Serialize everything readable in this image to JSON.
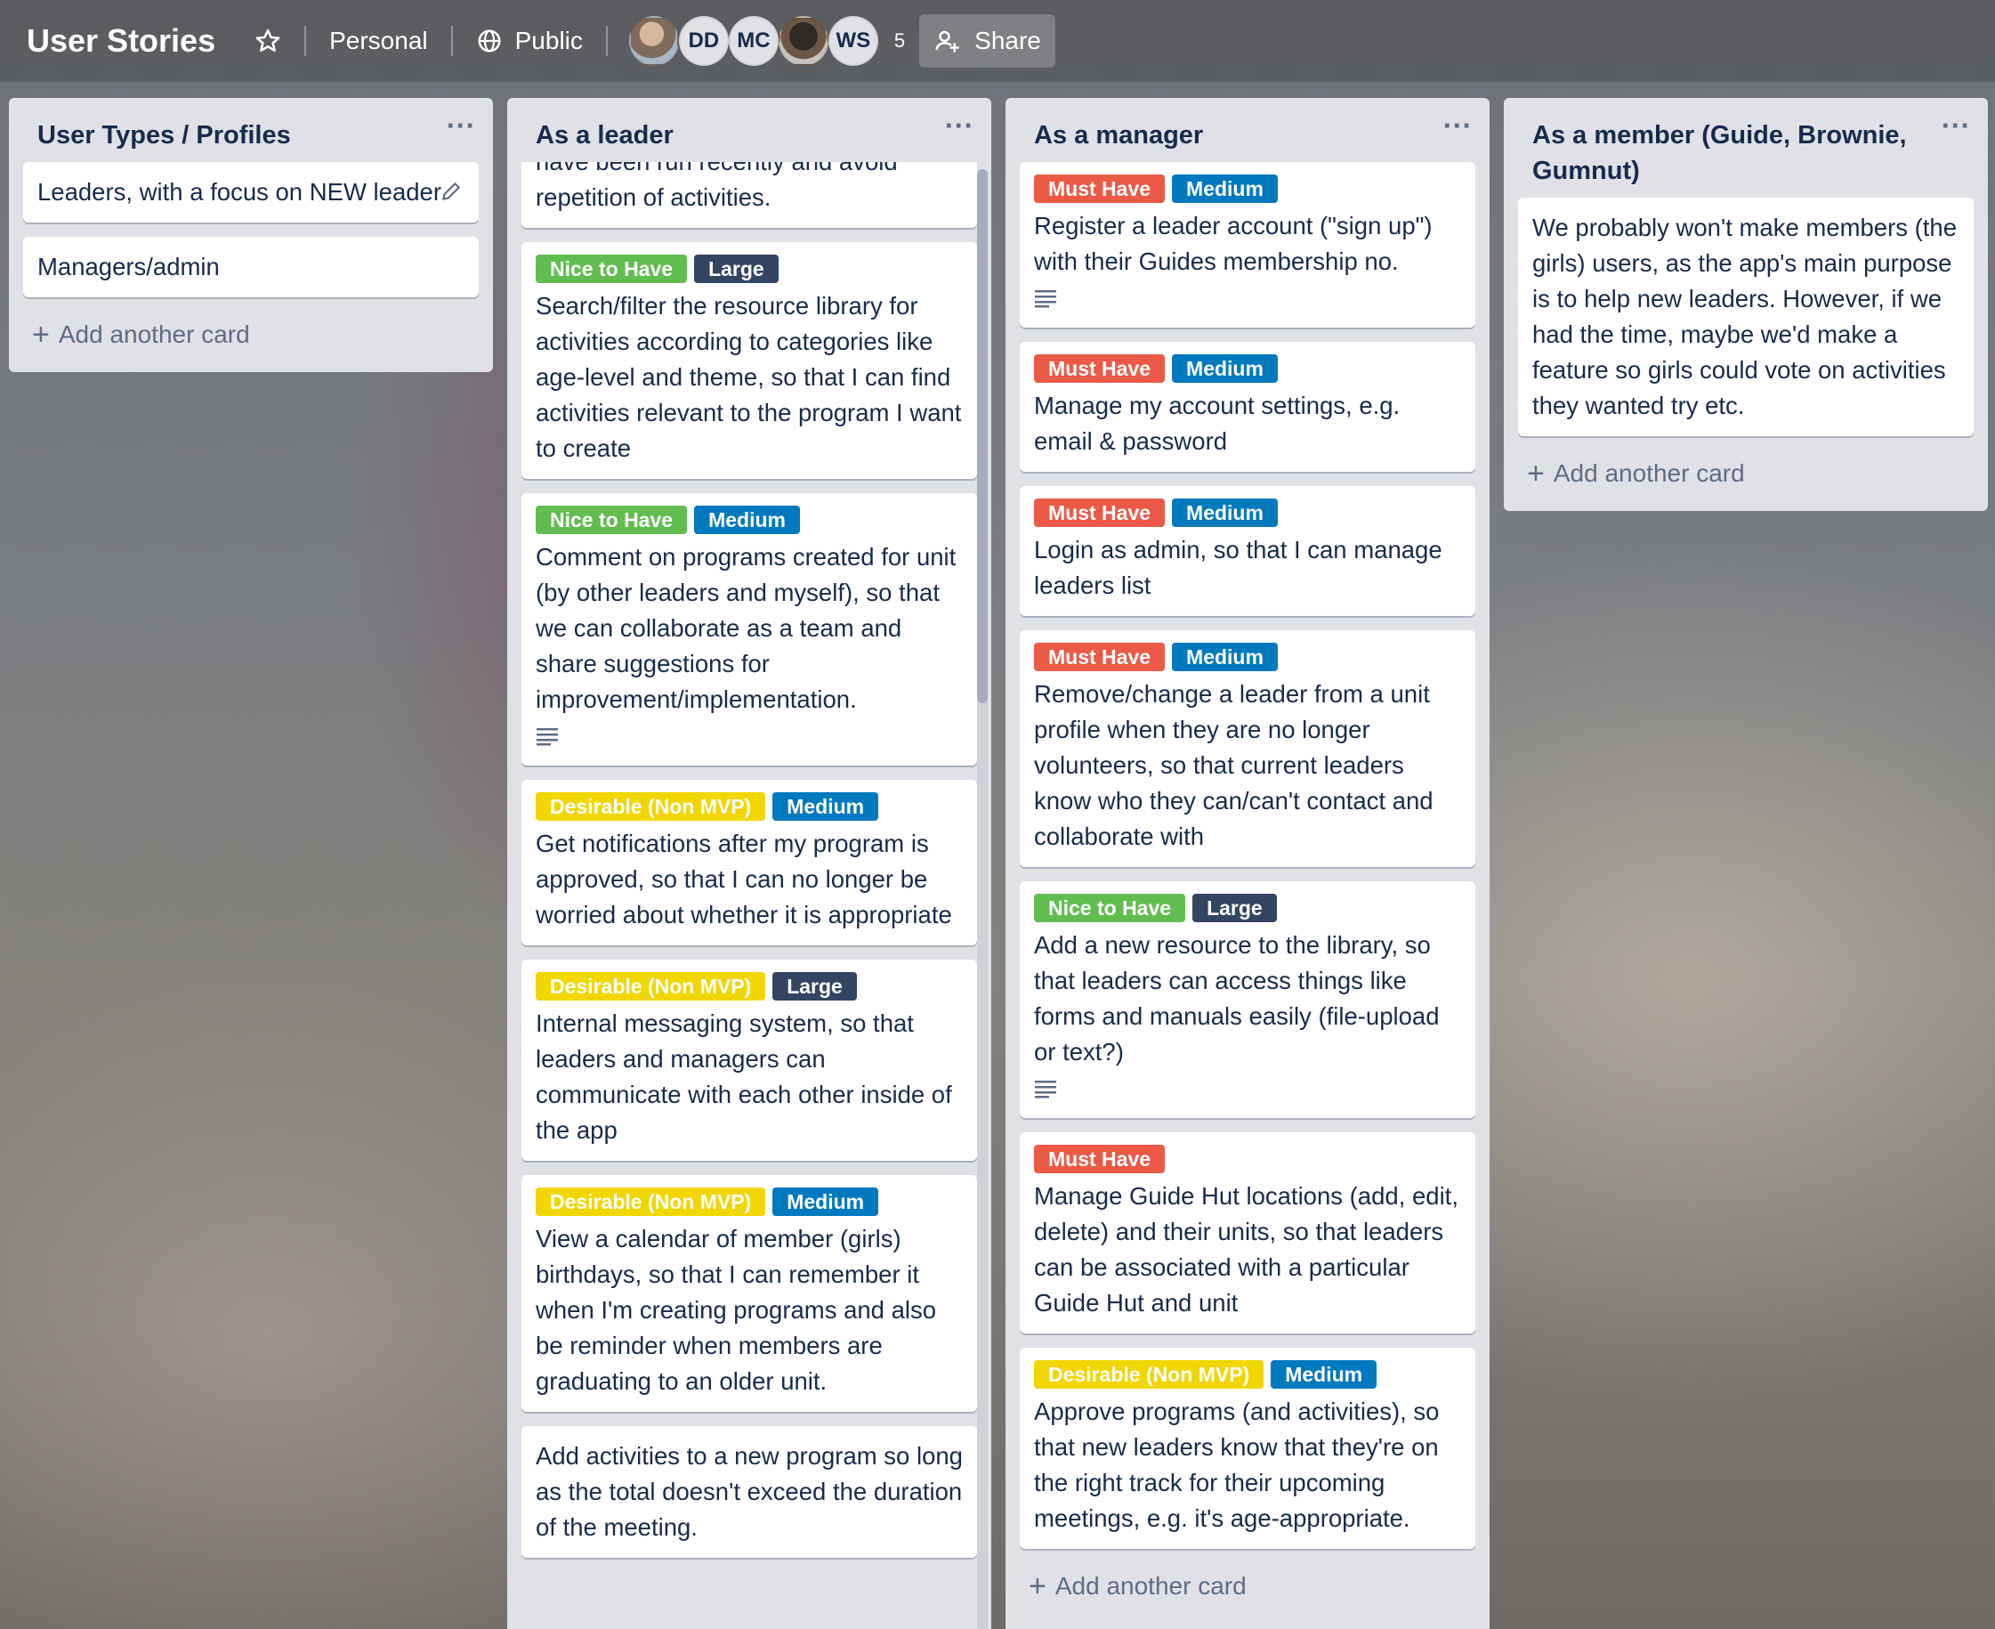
{
  "header": {
    "board_title": "User Stories",
    "visibility_team": "Personal",
    "visibility": "Public",
    "members": [
      {
        "initials": "",
        "kind": "photo"
      },
      {
        "initials": "DD",
        "kind": "initials"
      },
      {
        "initials": "MC",
        "kind": "initials"
      },
      {
        "initials": "",
        "kind": "photo"
      },
      {
        "initials": "WS",
        "kind": "initials"
      }
    ],
    "member_count": "5",
    "share_label": "Share"
  },
  "lists": [
    {
      "title": "User Types / Profiles",
      "cards": [
        {
          "text": "Leaders, with a focus on NEW leaders",
          "labels": []
        },
        {
          "text": "Managers/admin",
          "labels": []
        }
      ],
      "add_label": "Add another card"
    },
    {
      "title": "As a leader",
      "cards": [
        {
          "text": "have been run recently and avoid repetition of activities.",
          "labels": []
        },
        {
          "text": "Search/filter the resource library for activities according to categories like age-level and theme, so that I can find activities relevant to the program I want to create",
          "labels": [
            {
              "text": "Nice to Have",
              "color": "green"
            },
            {
              "text": "Large",
              "color": "dark"
            }
          ]
        },
        {
          "text": "Comment on programs created for unit (by other leaders and myself), so that we can collaborate as a team and share suggestions for improvement/implementation.",
          "labels": [
            {
              "text": "Nice to Have",
              "color": "green"
            },
            {
              "text": "Medium",
              "color": "blue"
            }
          ],
          "has_description": true
        },
        {
          "text": "Get notifications after my program is approved, so that I can no longer be worried about whether it is appropriate",
          "labels": [
            {
              "text": "Desirable (Non MVP)",
              "color": "yellow"
            },
            {
              "text": "Medium",
              "color": "blue"
            }
          ]
        },
        {
          "text": "Internal messaging system, so that leaders and managers can communicate with each other inside of the app",
          "labels": [
            {
              "text": "Desirable (Non MVP)",
              "color": "yellow"
            },
            {
              "text": "Large",
              "color": "dark"
            }
          ]
        },
        {
          "text": "View a calendar of member (girls) birthdays, so that I can remember it when I'm creating programs and also be reminder when members are graduating to an older unit.",
          "labels": [
            {
              "text": "Desirable (Non MVP)",
              "color": "yellow"
            },
            {
              "text": "Medium",
              "color": "blue"
            }
          ]
        },
        {
          "text": "Add activities to a new program so long as the total doesn't exceed the duration of the meeting.",
          "labels": []
        }
      ],
      "add_label": "Add another card"
    },
    {
      "title": "As a manager",
      "cards": [
        {
          "text": "Register a leader account (\"sign up\") with their Guides membership no.",
          "labels": [
            {
              "text": "Must Have",
              "color": "red"
            },
            {
              "text": "Medium",
              "color": "blue"
            }
          ],
          "has_description": true
        },
        {
          "text": "Manage my account settings, e.g. email & password",
          "labels": [
            {
              "text": "Must Have",
              "color": "red"
            },
            {
              "text": "Medium",
              "color": "blue"
            }
          ]
        },
        {
          "text": "Login as admin, so that I can manage leaders list",
          "labels": [
            {
              "text": "Must Have",
              "color": "red"
            },
            {
              "text": "Medium",
              "color": "blue"
            }
          ]
        },
        {
          "text": "Remove/change a leader from a unit profile when they are no longer volunteers, so that current leaders know who they can/can't contact and collaborate with",
          "labels": [
            {
              "text": "Must Have",
              "color": "red"
            },
            {
              "text": "Medium",
              "color": "blue"
            }
          ]
        },
        {
          "text": "Add a new resource to the library, so that leaders can access things like forms and manuals easily (file-upload or text?)",
          "labels": [
            {
              "text": "Nice to Have",
              "color": "green"
            },
            {
              "text": "Large",
              "color": "dark"
            }
          ],
          "has_description": true
        },
        {
          "text": "Manage Guide Hut locations (add, edit, delete) and their units, so that leaders can be associated with a particular Guide Hut and unit",
          "labels": [
            {
              "text": "Must Have",
              "color": "red"
            }
          ]
        },
        {
          "text": "Approve programs (and activities), so that new leaders know that they're on the right track for their upcoming meetings, e.g. it's age-appropriate.",
          "labels": [
            {
              "text": "Desirable (Non MVP)",
              "color": "yellow"
            },
            {
              "text": "Medium",
              "color": "blue"
            }
          ]
        }
      ],
      "add_label": "Add another card"
    },
    {
      "title": "As a member (Guide, Brownie, Gumnut)",
      "cards": [
        {
          "text": "We probably won't make members (the girls) users, as the app's main purpose is to help new leaders. However, if we had the time, maybe we'd make a feature so girls could vote on activities they wanted try etc.",
          "labels": []
        }
      ],
      "add_label": "Add another card"
    }
  ],
  "colors": {
    "green": "#61bd4f",
    "red": "#eb5a46",
    "blue": "#0079bf",
    "dark": "#344563",
    "yellow": "#f2d600"
  }
}
